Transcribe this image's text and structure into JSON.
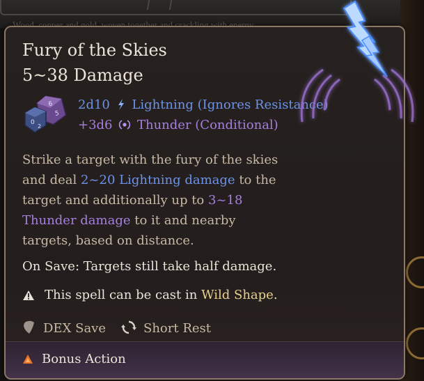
{
  "background": {
    "text": "Wood, copper and gold, woven together and crackling with energy"
  },
  "tooltip": {
    "title": "Fury of the Skies",
    "damage_range": "5~38 Damage",
    "damage_lines": [
      {
        "dice": "2d10",
        "type": "Lightning (Ignores Resistance)",
        "icon": "lightning-icon",
        "color": "#6d92e6"
      },
      {
        "dice": "+3d6",
        "type": "Thunder (Conditional)",
        "icon": "thunder-icon",
        "color": "#a77fe0"
      }
    ],
    "description": {
      "p1": "Strike a target with the fury of the skies and deal ",
      "lightning_amount": "2~20 Lightning damage",
      "p2": " to the target and additionally up to ",
      "thunder_amount": "3~18 Thunder damage",
      "p3": " to it and nearby targets, based on distance."
    },
    "on_save": "On Save: Targets still take half damage.",
    "wild_shape": {
      "prefix": "This spell can be cast in ",
      "highlight": "Wild Shape",
      "suffix": "."
    },
    "save_type": "DEX Save",
    "recharge": "Short Rest",
    "action_cost": "Bonus Action"
  },
  "colors": {
    "lightning": "#6d92e6",
    "thunder": "#a77fe0",
    "highlight": "#e8d28a",
    "bonus_action": "#e8742a"
  }
}
